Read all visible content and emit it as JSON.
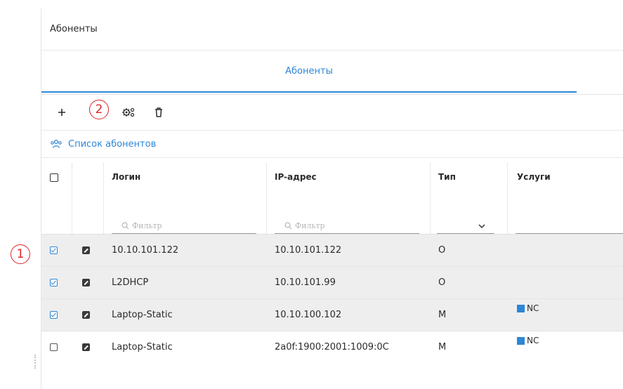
{
  "panel": {
    "title": "Абоненты"
  },
  "tabs": [
    {
      "label": "Абоненты",
      "active": true
    }
  ],
  "toolbar": {
    "add_icon": "plus-icon",
    "configure_icon": "gears-icon",
    "delete_icon": "trash-icon"
  },
  "section": {
    "icon": "users-icon",
    "title": "Список абонентов"
  },
  "table": {
    "columns": [
      {
        "key": "select",
        "label": ""
      },
      {
        "key": "edit",
        "label": ""
      },
      {
        "key": "login",
        "label": "Логин",
        "filter_placeholder": "Фильтр"
      },
      {
        "key": "ip",
        "label": "IP-адрес",
        "filter_placeholder": "Фильтр"
      },
      {
        "key": "type",
        "label": "Тип"
      },
      {
        "key": "services",
        "label": "Услуги"
      }
    ],
    "rows": [
      {
        "selected": true,
        "login": "10.10.101.122",
        "ip": "10.10.101.122",
        "type": "O",
        "services": ""
      },
      {
        "selected": true,
        "login": "L2DHCP",
        "ip": "10.10.101.99",
        "type": "O",
        "services": ""
      },
      {
        "selected": true,
        "login": "Laptop-Static",
        "ip": "10.10.100.102",
        "type": "M",
        "services": "NC"
      },
      {
        "selected": false,
        "login": "Laptop-Static",
        "ip": "2a0f:1900:2001:1009:0C",
        "type": "M",
        "services": "NC"
      }
    ]
  },
  "annotations": [
    {
      "number": "1"
    },
    {
      "number": "2"
    }
  ],
  "colors": {
    "accent": "#2d86d6",
    "annotation": "#e0262b",
    "selected_row_bg": "#eeeeef"
  }
}
